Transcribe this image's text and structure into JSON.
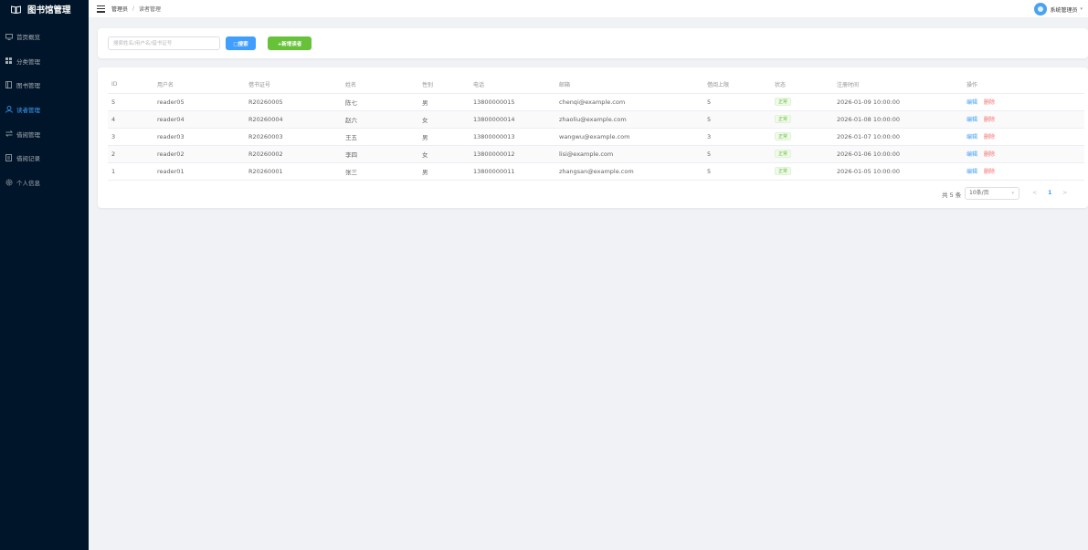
{
  "app": {
    "title": "图书馆管理"
  },
  "sidebar": {
    "items": [
      {
        "label": "首页概览",
        "icon": "monitor-icon"
      },
      {
        "label": "分类管理",
        "icon": "grid-icon"
      },
      {
        "label": "图书管理",
        "icon": "book-icon"
      },
      {
        "label": "读者管理",
        "icon": "user-icon",
        "active": true
      },
      {
        "label": "借阅管理",
        "icon": "swap-icon"
      },
      {
        "label": "借阅记录",
        "icon": "document-icon"
      },
      {
        "label": "个人信息",
        "icon": "gear-icon"
      }
    ]
  },
  "header": {
    "breadcrumb": [
      "管理员",
      "读者管理"
    ],
    "separator": "/",
    "user_name": "系统管理员"
  },
  "search": {
    "placeholder": "搜索姓名/用户名/借书证号",
    "search_button": "□搜索",
    "add_button": "+新增读者"
  },
  "table": {
    "columns": [
      "ID",
      "用户名",
      "借书证号",
      "姓名",
      "性别",
      "电话",
      "邮箱",
      "借阅上限",
      "状态",
      "注册时间",
      "操作"
    ],
    "rows": [
      {
        "id": "5",
        "username": "reader05",
        "card_no": "R20260005",
        "name": "陈七",
        "gender": "男",
        "phone": "13800000015",
        "email": "chenqi@example.com",
        "limit": "5",
        "status": "正常",
        "registered": "2026-01-09 10:00:00"
      },
      {
        "id": "4",
        "username": "reader04",
        "card_no": "R20260004",
        "name": "赵六",
        "gender": "女",
        "phone": "13800000014",
        "email": "zhaoliu@example.com",
        "limit": "5",
        "status": "正常",
        "registered": "2026-01-08 10:00:00"
      },
      {
        "id": "3",
        "username": "reader03",
        "card_no": "R20260003",
        "name": "王五",
        "gender": "男",
        "phone": "13800000013",
        "email": "wangwu@example.com",
        "limit": "3",
        "status": "正常",
        "registered": "2026-01-07 10:00:00"
      },
      {
        "id": "2",
        "username": "reader02",
        "card_no": "R20260002",
        "name": "李四",
        "gender": "女",
        "phone": "13800000012",
        "email": "lisi@example.com",
        "limit": "5",
        "status": "正常",
        "registered": "2026-01-06 10:00:00"
      },
      {
        "id": "1",
        "username": "reader01",
        "card_no": "R20260001",
        "name": "张三",
        "gender": "男",
        "phone": "13800000011",
        "email": "zhangsan@example.com",
        "limit": "5",
        "status": "正常",
        "registered": "2026-01-05 10:00:00"
      }
    ],
    "actions": {
      "edit": "编辑",
      "delete": "删除"
    }
  },
  "pagination": {
    "total_text": "共 5 条",
    "page_size": "10条/页",
    "prev": "<",
    "current_page": "1",
    "next": ">"
  },
  "colors": {
    "sidebar_bg": "#001529",
    "primary": "#409eff",
    "success": "#67c23a",
    "danger": "#f56c6c"
  }
}
